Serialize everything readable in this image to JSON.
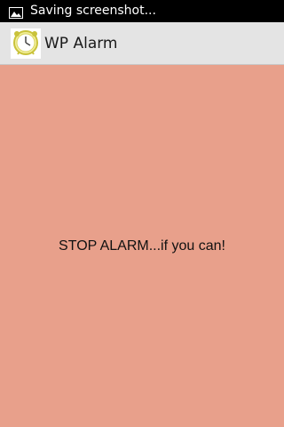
{
  "status_bar": {
    "notification_icon": "image-icon",
    "text": "Saving screenshot..."
  },
  "action_bar": {
    "app_icon": "alarm-clock-icon",
    "title": "WP Alarm"
  },
  "main": {
    "message": "STOP ALARM...if you can!"
  },
  "colors": {
    "status_bar_bg": "#000000",
    "action_bar_bg": "#e4e4e4",
    "content_bg": "#e8a08b",
    "text": "#111111"
  }
}
